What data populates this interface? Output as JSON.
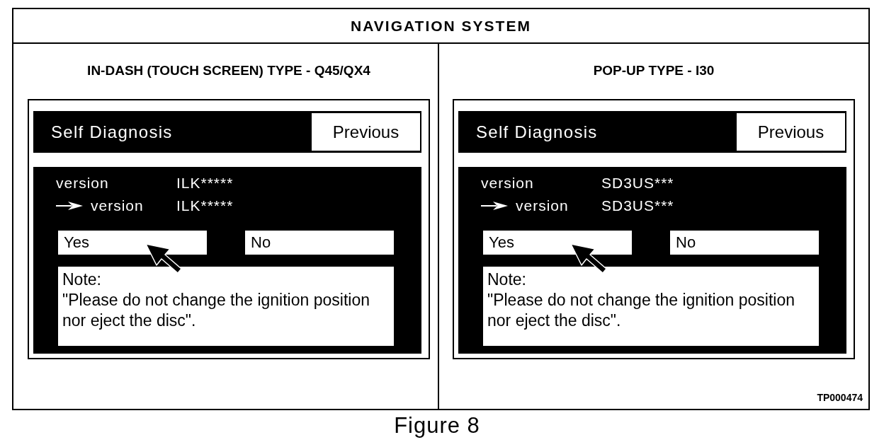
{
  "title": "NAVIGATION SYSTEM",
  "panels": [
    {
      "heading": "IN-DASH (TOUCH SCREEN) TYPE - Q45/QX4",
      "screen": {
        "title": "Self Diagnosis",
        "previous": "Previous",
        "versions": [
          {
            "label": "version",
            "value": "ILK*****",
            "arrow": false
          },
          {
            "label": "version",
            "value": "ILK*****",
            "arrow": true
          }
        ],
        "choices": [
          {
            "label": "Yes",
            "pointed": true
          },
          {
            "label": "No",
            "pointed": false
          }
        ],
        "note": {
          "label": "Note:",
          "text": "\"Please do not change the ignition position\nnor eject the disc\"."
        }
      }
    },
    {
      "heading": "POP-UP TYPE - I30",
      "screen": {
        "title": "Self Diagnosis",
        "previous": "Previous",
        "versions": [
          {
            "label": "version",
            "value": "SD3US***",
            "arrow": false
          },
          {
            "label": "version",
            "value": "SD3US***",
            "arrow": true
          }
        ],
        "choices": [
          {
            "label": "Yes",
            "pointed": true
          },
          {
            "label": "No",
            "pointed": false
          }
        ],
        "note": {
          "label": "Note:",
          "text": "\"Please do not change the ignition position\nnor eject the disc\"."
        }
      }
    }
  ],
  "code": "TP000474",
  "caption": "Figure 8"
}
